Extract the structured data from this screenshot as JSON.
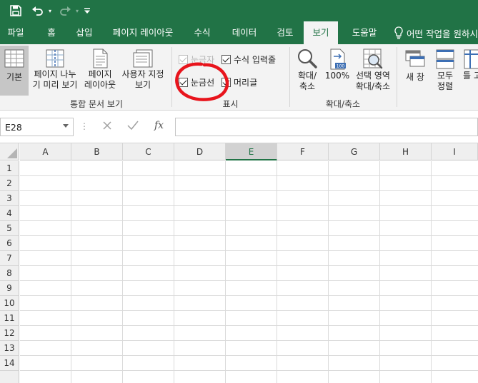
{
  "titlebar": {
    "bg_color": "#217346",
    "save_icon": "save-icon",
    "undo_icon": "undo-icon",
    "redo_icon": "redo-icon",
    "customize_icon": "customize-qat-icon"
  },
  "tabs": [
    {
      "label": "파일",
      "active": false
    },
    {
      "label": "홈",
      "active": false
    },
    {
      "label": "삽입",
      "active": false
    },
    {
      "label": "페이지 레이아웃",
      "active": false
    },
    {
      "label": "수식",
      "active": false
    },
    {
      "label": "데이터",
      "active": false
    },
    {
      "label": "검토",
      "active": false
    },
    {
      "label": "보기",
      "active": true
    },
    {
      "label": "도움말",
      "active": false
    }
  ],
  "tellme": {
    "label": "어떤 작업을 원하시",
    "icon": "lightbulb-icon"
  },
  "ribbon": {
    "workbook_views": {
      "group_label": "통합 문서 보기",
      "normal": {
        "label": "기본"
      },
      "page_break": {
        "line1": "페이지 나누",
        "line2": "기 미리 보기"
      },
      "page_layout": {
        "line1": "페이지",
        "line2": "레이아웃"
      },
      "custom_views": {
        "line1": "사용자 지정",
        "line2": "보기"
      }
    },
    "show": {
      "group_label": "표시",
      "ruler": {
        "label": "눈금자",
        "checked": true,
        "enabled": false
      },
      "formula_bar": {
        "label": "수식 입력줄",
        "checked": true
      },
      "gridlines": {
        "label": "눈금선",
        "checked": true
      },
      "headings": {
        "label": "머리글",
        "checked": true
      }
    },
    "zoom": {
      "group_label": "확대/축소",
      "zoom": {
        "line1": "확대/",
        "line2": "축소"
      },
      "hundred": {
        "label": "100%",
        "badge": "100"
      },
      "zoom_selection": {
        "line1": "선택 영역",
        "line2": "확대/축소"
      }
    },
    "window": {
      "new_window": {
        "label": "새 창"
      },
      "arrange_all": {
        "line1": "모두",
        "line2": "정렬"
      },
      "freeze": {
        "line1": "틀 고"
      }
    }
  },
  "formula_bar": {
    "name_box": "E28",
    "cancel_icon": "cancel-icon",
    "enter_icon": "enter-icon",
    "fx_label": "fx",
    "formula": ""
  },
  "grid": {
    "columns": [
      "A",
      "B",
      "C",
      "D",
      "E",
      "F",
      "G",
      "H",
      "I"
    ],
    "selected_column": "E",
    "rows": [
      "1",
      "2",
      "3",
      "4",
      "5",
      "6",
      "7",
      "8",
      "9",
      "10",
      "11",
      "12",
      "13",
      "14"
    ],
    "accent_color": "#217346"
  },
  "annotation": {
    "shape": "red hand-drawn circle around gridlines checkbox",
    "color": "#e8141c"
  }
}
